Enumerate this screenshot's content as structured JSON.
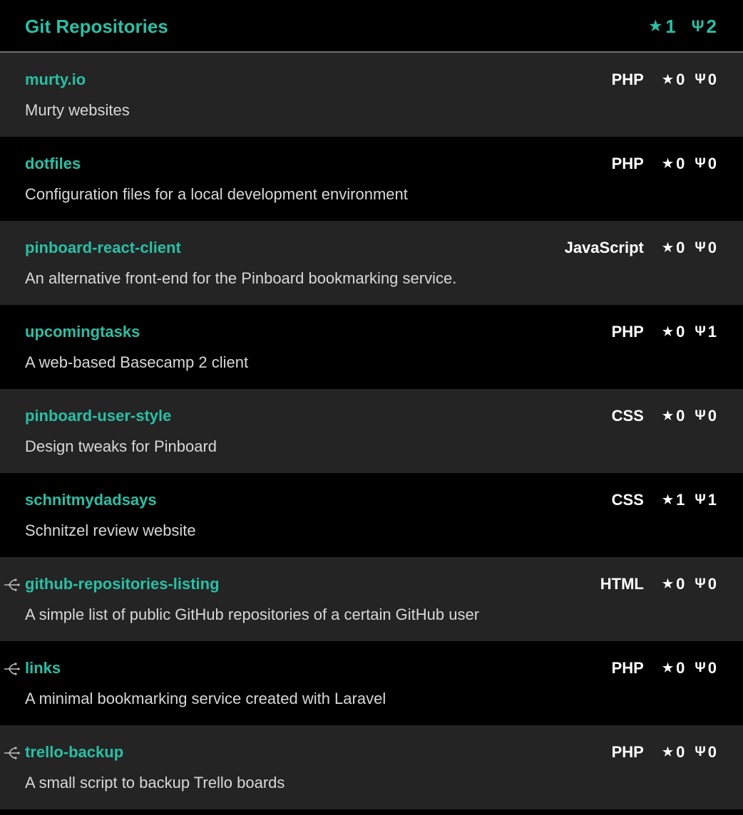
{
  "header": {
    "title": "Git Repositories",
    "stars": "1",
    "forks": "2"
  },
  "glyphs": {
    "star": "★",
    "fork": "Ψ"
  },
  "colors": {
    "accent": "#2bbfa5",
    "row_odd": "#242424",
    "row_even": "#000000",
    "text": "#ffffff",
    "description": "#d8d8d8"
  },
  "repos": [
    {
      "name": "murty.io",
      "description": "Murty websites",
      "language": "PHP",
      "stars": "0",
      "forks": "0",
      "is_fork": false
    },
    {
      "name": "dotfiles",
      "description": "Configuration files for a local development environment",
      "language": "PHP",
      "stars": "0",
      "forks": "0",
      "is_fork": false
    },
    {
      "name": "pinboard-react-client",
      "description": "An alternative front-end for the Pinboard bookmarking service.",
      "language": "JavaScript",
      "stars": "0",
      "forks": "0",
      "is_fork": false
    },
    {
      "name": "upcomingtasks",
      "description": "A web-based Basecamp 2 client",
      "language": "PHP",
      "stars": "0",
      "forks": "1",
      "is_fork": false
    },
    {
      "name": "pinboard-user-style",
      "description": "Design tweaks for Pinboard",
      "language": "CSS",
      "stars": "0",
      "forks": "0",
      "is_fork": false
    },
    {
      "name": "schnitmydadsays",
      "description": "Schnitzel review website",
      "language": "CSS",
      "stars": "1",
      "forks": "1",
      "is_fork": false
    },
    {
      "name": "github-repositories-listing",
      "description": "A simple list of public GitHub repositories of a certain GitHub user",
      "language": "HTML",
      "stars": "0",
      "forks": "0",
      "is_fork": true
    },
    {
      "name": "links",
      "description": "A minimal bookmarking service created with Laravel",
      "language": "PHP",
      "stars": "0",
      "forks": "0",
      "is_fork": true
    },
    {
      "name": "trello-backup",
      "description": "A small script to backup Trello boards",
      "language": "PHP",
      "stars": "0",
      "forks": "0",
      "is_fork": true
    }
  ]
}
